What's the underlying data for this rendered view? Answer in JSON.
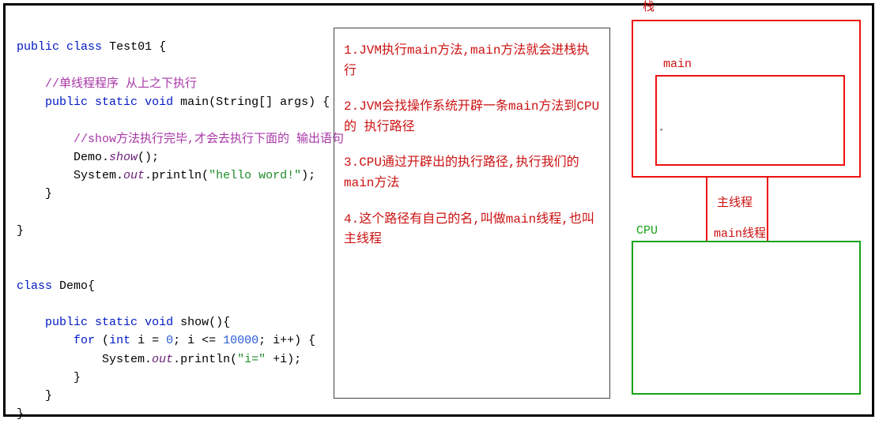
{
  "code": {
    "l1a": "public",
    "l1b": "class",
    "l1c": "Test01 {",
    "l2": "//单线程程序 从上之下执行",
    "l3a": "public",
    "l3b": "static",
    "l3c": "void",
    "l3d": "main(String[] args) {",
    "l4": "//show方法执行完毕,才会去执行下面的 输出语句",
    "l5a": "Demo.",
    "l5b": "show",
    "l5c": "();",
    "l6a": "System.",
    "l6b": "out",
    "l6c": ".println(",
    "l6d": "\"hello word!\"",
    "l6e": ");",
    "l7": "}",
    "l8": "}",
    "l9a": "class",
    "l9b": "Demo{",
    "l10a": "public",
    "l10b": "static",
    "l10c": "void",
    "l10d": "show(){",
    "l11a": "for",
    "l11b": "(",
    "l11c": "int",
    "l11d": " i = ",
    "l11e": "0",
    "l11f": "; i <= ",
    "l11g": "10000",
    "l11h": "; i++) {",
    "l12a": "System.",
    "l12b": "out",
    "l12c": ".println(",
    "l12d": "\"i=\"",
    "l12e": " +i);",
    "l13": "}",
    "l14": "}",
    "l15": "}"
  },
  "notes": {
    "n1": "1.JVM执行main方法,main方法就会进栈执行",
    "n2": "2.JVM会找操作系统开辟一条main方法到CPU的 执行路径",
    "n3": "3.CPU通过开辟出的执行路径,执行我们的main方法",
    "n4": "4.这个路径有自己的名,叫做main线程,也叫主线程"
  },
  "diagram": {
    "stack": "栈",
    "main": "main",
    "dot": "。",
    "mainline": "主线程",
    "cpu": "CPU",
    "mainthread": "main线程"
  }
}
